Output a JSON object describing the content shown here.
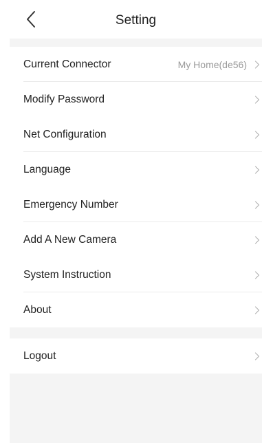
{
  "header": {
    "title": "Setting"
  },
  "colors": {
    "background": "#f4f4f4",
    "row_background": "#ffffff",
    "divider": "#ebebeb",
    "secondary_text": "#9a9a9a",
    "chevron": "#b5b5b5"
  },
  "menu": {
    "items": [
      {
        "label": "Current Connector",
        "value": "My Home(de56)"
      },
      {
        "label": "Modify Password"
      },
      {
        "label": "Net Configuration"
      },
      {
        "label": "Language"
      },
      {
        "label": "Emergency Number"
      },
      {
        "label": "Add A New Camera"
      },
      {
        "label": "System Instruction"
      },
      {
        "label": "About"
      }
    ]
  },
  "logout": {
    "label": "Logout"
  },
  "icons": {
    "back": "chevron-left-icon",
    "row_arrow": "chevron-right-icon"
  }
}
